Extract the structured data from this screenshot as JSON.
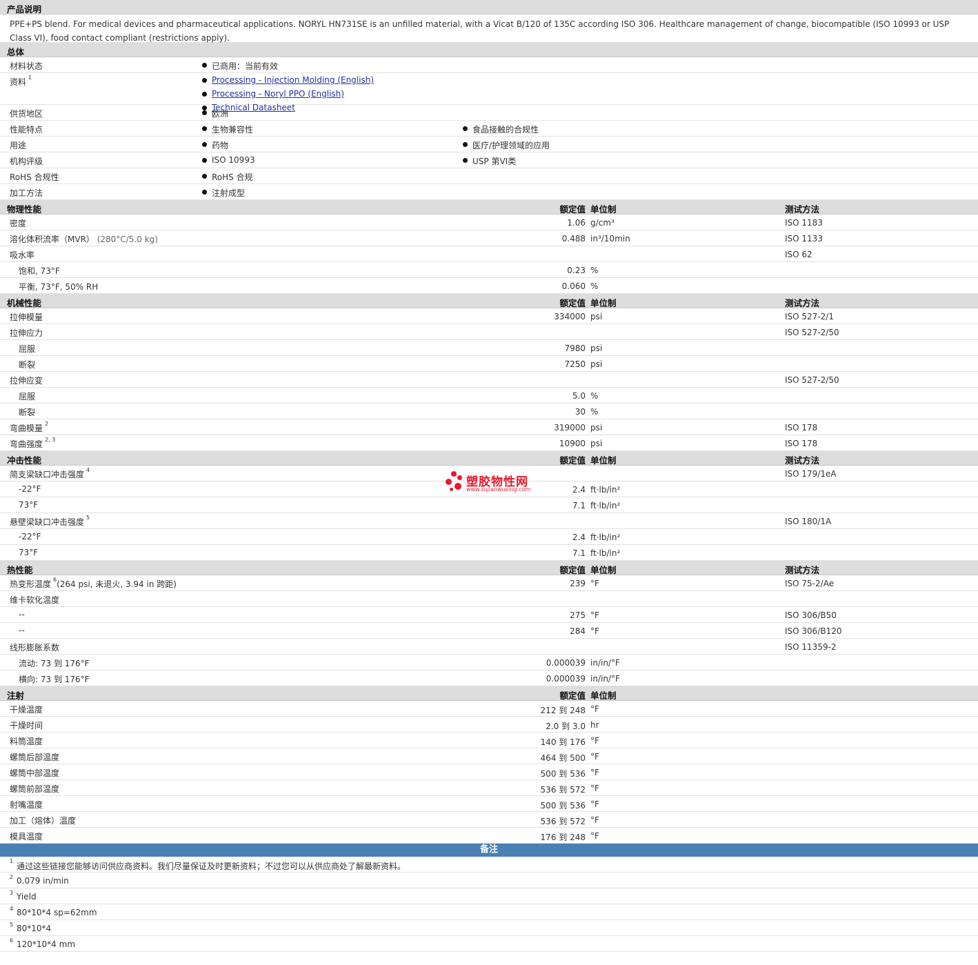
{
  "product": {
    "title": "产品说明",
    "description": "PPE+PS blend. For medical devices and pharmaceutical applications. NORYL HN731SE is an unfilled material, with a Vicat B/120 of 135C according ISO 306. Healthcare management of change, biocompatible (ISO 10993 or USP Class VI), food contact compliant (restrictions apply)."
  },
  "general": {
    "title": "总体",
    "status": {
      "label": "材料状态",
      "value": "已商用：当前有效"
    },
    "docs": {
      "label": "资料",
      "note": "1",
      "links": [
        "Processing - Injection Molding (English)",
        "Processing - Noryl PPO (English)",
        "Technical Datasheet"
      ]
    },
    "region": {
      "label": "供货地区",
      "value": "欧洲"
    },
    "features": {
      "label": "性能特点",
      "v1": "生物兼容性",
      "v2": "食品接触的合规性"
    },
    "uses": {
      "label": "用途",
      "v1": "药物",
      "v2": "医疗/护理领域的应用"
    },
    "agency": {
      "label": "机构评级",
      "v1": "ISO 10993",
      "v2": "USP 第VI类"
    },
    "rohs": {
      "label": "RoHS 合规性",
      "value": "RoHS 合规"
    },
    "processing": {
      "label": "加工方法",
      "value": "注射成型"
    }
  },
  "headers": {
    "value": "额定值",
    "unit": "单位制",
    "method": "测试方法"
  },
  "physical": {
    "title": "物理性能",
    "density": {
      "label": "密度",
      "value": "1.06",
      "unit": "g/cm³",
      "method": "ISO 1183"
    },
    "mvr": {
      "label": "溶化体积流率（MVR）",
      "cond": "(280°C/5.0 kg)",
      "value": "0.488",
      "unit": "in³/10min",
      "method": "ISO 1133"
    },
    "water": {
      "label": "吸水率",
      "method": "ISO 62"
    },
    "sat": {
      "label": "饱和, 73°F",
      "value": "0.23",
      "unit": "%"
    },
    "eq": {
      "label": "平衡, 73°F, 50% RH",
      "value": "0.060",
      "unit": "%"
    }
  },
  "mechanical": {
    "title": "机械性能",
    "tmod": {
      "label": "拉伸模量",
      "value": "334000",
      "unit": "psi",
      "method": "ISO 527-2/1"
    },
    "tstress": {
      "label": "拉伸应力",
      "method": "ISO 527-2/50"
    },
    "ty": {
      "label": "屈服",
      "value": "7980",
      "unit": "psi"
    },
    "tb": {
      "label": "断裂",
      "value": "7250",
      "unit": "psi"
    },
    "tstrain": {
      "label": "拉伸应变",
      "method": "ISO 527-2/50"
    },
    "sy": {
      "label": "屈服",
      "value": "5.0",
      "unit": "%"
    },
    "sb": {
      "label": "断裂",
      "value": "30",
      "unit": "%"
    },
    "fmod": {
      "label": "弯曲模量",
      "note": "2",
      "value": "319000",
      "unit": "psi",
      "method": "ISO 178"
    },
    "fstr": {
      "label": "弯曲强度",
      "note": "2, 3",
      "value": "10900",
      "unit": "psi",
      "method": "ISO 178"
    }
  },
  "impact": {
    "title": "冲击性能",
    "charpy": {
      "label": "简支梁缺口冲击强度",
      "note": "4",
      "method": "ISO 179/1eA"
    },
    "c1": {
      "label": "-22°F",
      "value": "2.4",
      "unit": "ft·lb/in²"
    },
    "c2": {
      "label": "73°F",
      "value": "7.1",
      "unit": "ft·lb/in²"
    },
    "izod": {
      "label": "悬壁梁缺口冲击强度",
      "note": "5",
      "method": "ISO 180/1A"
    },
    "i1": {
      "label": "-22°F",
      "value": "2.4",
      "unit": "ft·lb/in²"
    },
    "i2": {
      "label": "73°F",
      "value": "7.1",
      "unit": "ft·lb/in²"
    }
  },
  "thermal": {
    "title": "热性能",
    "hdt": {
      "label": "热变形温度",
      "note": "6",
      "cond": "(264 psi, 未退火, 3.94 in 跨距)",
      "value": "239",
      "unit": "°F",
      "method": "ISO 75-2/Ae"
    },
    "vicat": {
      "label": "维卡软化温度"
    },
    "v1": {
      "label": "--",
      "value": "275",
      "unit": "°F",
      "method": "ISO 306/B50"
    },
    "v2": {
      "label": "--",
      "value": "284",
      "unit": "°F",
      "method": "ISO 306/B120"
    },
    "clte": {
      "label": "线形膨胀系数",
      "method": "ISO 11359-2"
    },
    "flow": {
      "label": "流动: 73 到 176°F",
      "value": "0.000039",
      "unit": "in/in/°F"
    },
    "trans": {
      "label": "横向: 73 到 176°F",
      "value": "0.000039",
      "unit": "in/in/°F"
    }
  },
  "injection": {
    "title": "注射",
    "rows": [
      {
        "label": "干燥温度",
        "value": "212 到 248",
        "unit": "°F"
      },
      {
        "label": "干燥时间",
        "value": "2.0 到 3.0",
        "unit": "hr"
      },
      {
        "label": "料筒温度",
        "value": "140 到 176",
        "unit": "°F"
      },
      {
        "label": "螺筒后部温度",
        "value": "464 到 500",
        "unit": "°F"
      },
      {
        "label": "螺筒中部温度",
        "value": "500 到 536",
        "unit": "°F"
      },
      {
        "label": "螺筒前部温度",
        "value": "536 到 572",
        "unit": "°F"
      },
      {
        "label": "射嘴温度",
        "value": "500 到 536",
        "unit": "°F"
      },
      {
        "label": "加工（熔体）温度",
        "value": "536 到 572",
        "unit": "°F"
      },
      {
        "label": "模具温度",
        "value": "176 到 248",
        "unit": "°F"
      }
    ]
  },
  "notes": {
    "title": "备注",
    "rows": [
      {
        "n": "1",
        "text": "通过这些链接您能够访问供应商资料。我们尽量保证及时更新资料；不过您可以从供应商处了解最新资料。"
      },
      {
        "n": "2",
        "text": "0.079 in/min"
      },
      {
        "n": "3",
        "text": "Yield"
      },
      {
        "n": "4",
        "text": "80*10*4 sp=62mm"
      },
      {
        "n": "5",
        "text": "80*10*4"
      },
      {
        "n": "6",
        "text": "120*10*4 mm"
      }
    ]
  },
  "watermark": {
    "name": "塑胶物性网",
    "url": "www.sujiaowuxing.com",
    "color": "#e8192c"
  }
}
